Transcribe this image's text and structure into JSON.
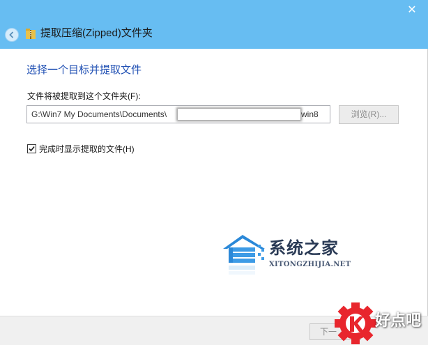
{
  "window": {
    "title": "提取压缩(Zipped)文件夹",
    "close_glyph": "✕"
  },
  "wizard": {
    "heading": "选择一个目标并提取文件",
    "field_label": "文件将被提取到这个文件夹(F):",
    "path_prefix": "G:\\Win7 My Documents\\Documents\\",
    "path_suffix": "win8",
    "browse_label": "浏览(R)...",
    "checkbox_label": "完成时显示提取的文件(H)",
    "checkbox_checked": true,
    "next_label": "下一"
  },
  "watermark": {
    "name": "系统之家",
    "domain": "XITONGZHIJIA.NET"
  },
  "badge": {
    "text": "好点吧"
  },
  "colors": {
    "titlebar": "#67bdf2",
    "heading": "#1f4fb3",
    "badge_red": "#e8262d"
  }
}
